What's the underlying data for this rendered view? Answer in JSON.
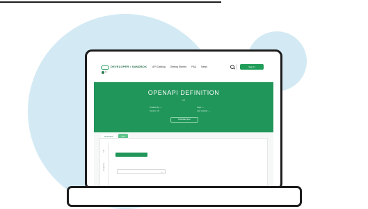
{
  "header": {
    "logo_text": "DEVELOPER • SANDBOX",
    "logo_sub": "by ",
    "nav": [
      "API Catalog",
      "Getting Started",
      "FAQ",
      "News"
    ],
    "signin_label": "Sign In"
  },
  "banner": {
    "title": "OPENAPI DEFINITION",
    "subtitle": "v0",
    "meta_left": [
      "Created by: —",
      "Version: v0"
    ],
    "meta_right": [
      "Tags: —",
      "Last Update: —"
    ],
    "download_label": "Download spec",
    "tabs": [
      "Overview",
      "API"
    ]
  },
  "content": {
    "side_labels": [
      "API",
      "Endpoints"
    ],
    "endpoint_button": "",
    "select_label": "",
    "select_value": ""
  },
  "colors": {
    "brand_green": "#21965a",
    "circle_blue": "#d3eaf4",
    "outline": "#1c1c1c"
  }
}
